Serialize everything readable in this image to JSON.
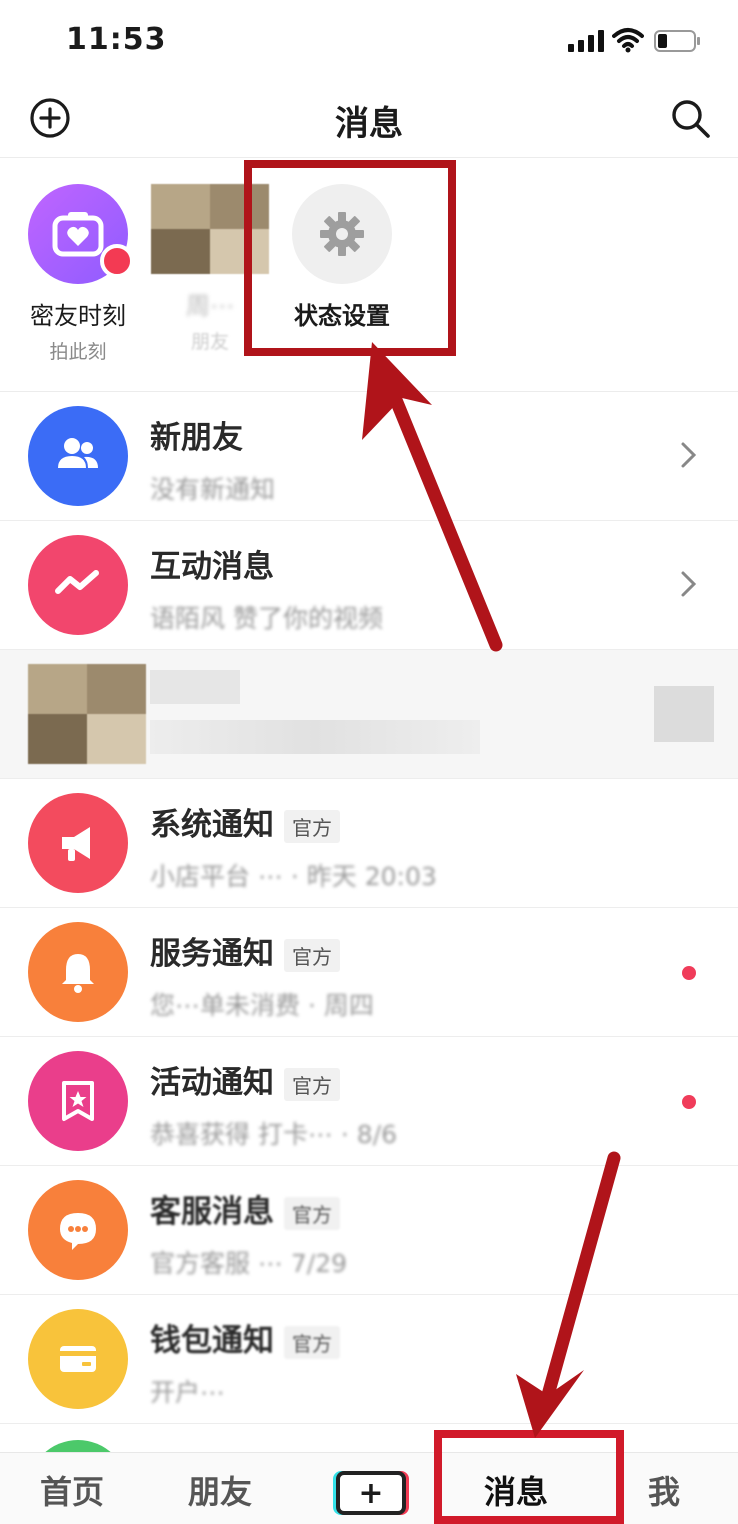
{
  "status_bar": {
    "time": "11:53"
  },
  "header": {
    "title": "消息"
  },
  "stories": [
    {
      "name": "密友时刻",
      "sub": "拍此刻"
    },
    {
      "name": "周⋯",
      "sub": "朋友"
    },
    {
      "name": "状态设置",
      "sub": ""
    }
  ],
  "list": [
    {
      "title": "新朋友",
      "badge": "",
      "sub": "没有新通知",
      "accessory": "chevron",
      "icon": "friends-icon",
      "color": "#3b6cf6"
    },
    {
      "title": "互动消息",
      "badge": "",
      "sub": "语陌风 赞了你的视频",
      "accessory": "chevron",
      "icon": "interaction-icon",
      "color": "#f2466d"
    },
    {
      "title": "",
      "badge": "",
      "sub": "",
      "accessory": "",
      "icon": "blurred-avatar",
      "color": "#f6f6f6"
    },
    {
      "title": "系统通知",
      "badge": "官方",
      "sub": "小店平台 ⋯ · 昨天 20:03",
      "accessory": "",
      "icon": "megaphone-icon",
      "color": "#f34b5e"
    },
    {
      "title": "服务通知",
      "badge": "官方",
      "sub": "您⋯单未消费 · 周四",
      "accessory": "dot",
      "icon": "bell-icon",
      "color": "#f8803b"
    },
    {
      "title": "活动通知",
      "badge": "官方",
      "sub": "恭喜获得 打卡⋯ · 8/6",
      "accessory": "dot",
      "icon": "star-ribbon-icon",
      "color": "#ea3e8b"
    },
    {
      "title": "客服消息",
      "badge": "官方",
      "sub": "官方客服 ⋯ 7/29",
      "accessory": "",
      "icon": "chat-bubble-icon",
      "color": "#f8803b"
    },
    {
      "title": "钱包通知",
      "badge": "官方",
      "sub": "开户⋯",
      "accessory": "",
      "icon": "wallet-card-icon",
      "color": "#f8c33b"
    }
  ],
  "tabbar": {
    "home": "首页",
    "friends": "朋友",
    "plus": "+",
    "messages": "消息",
    "me": "我"
  }
}
